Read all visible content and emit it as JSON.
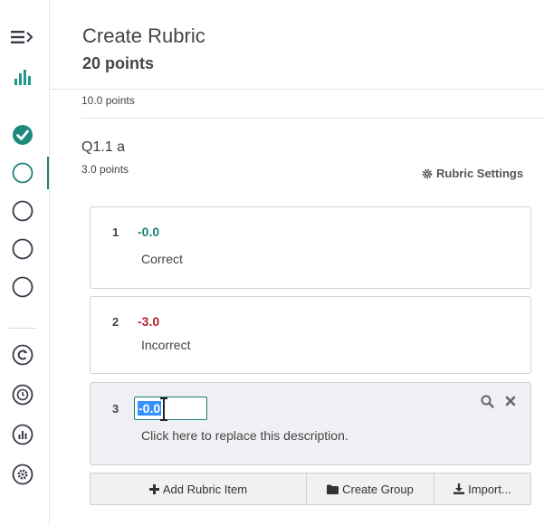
{
  "header": {
    "title": "Create Rubric",
    "points": "20 points"
  },
  "previous_question": {
    "points": "10.0 points"
  },
  "question": {
    "title": "Q1.1 a",
    "points": "3.0 points",
    "settings_label": "Rubric Settings"
  },
  "rubric_items": [
    {
      "number": "1",
      "points": "-0.0",
      "description": "Correct"
    },
    {
      "number": "2",
      "points": "-3.0",
      "description": "Incorrect"
    },
    {
      "number": "3",
      "points": "-0.0",
      "description": "Click here to replace this description."
    }
  ],
  "toolbar": {
    "add_label": "Add Rubric Item",
    "group_label": "Create Group",
    "import_label": "Import..."
  },
  "colors": {
    "accent": "#1e7f7a",
    "positive": "#1e7f7a",
    "negative": "#b2212b",
    "selection": "#3390ff"
  }
}
